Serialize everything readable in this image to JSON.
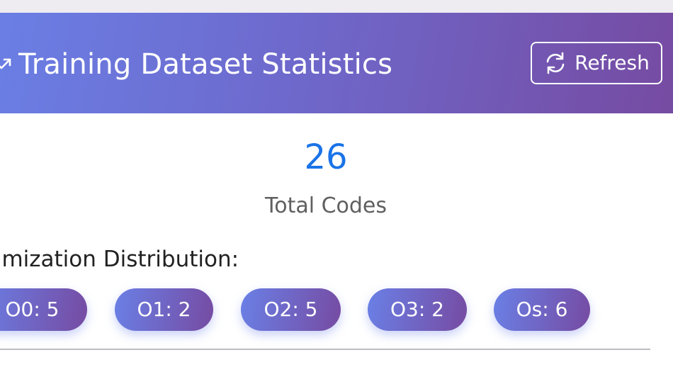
{
  "header": {
    "icon": "trend-up-icon",
    "title": "Training Dataset Statistics",
    "refresh_icon": "refresh-icon",
    "refresh_label": "Refresh",
    "gradient_start": "#667eea",
    "gradient_end": "#764ba2"
  },
  "summary": {
    "total_value": "26",
    "total_label": "Total Codes",
    "value_color": "#1a73e8"
  },
  "distribution": {
    "heading": "ptimization Distribution:",
    "chips": [
      {
        "label": "O0: 5"
      },
      {
        "label": "O1: 2"
      },
      {
        "label": "O2: 5"
      },
      {
        "label": "O3: 2"
      },
      {
        "label": "Os: 6"
      }
    ]
  }
}
